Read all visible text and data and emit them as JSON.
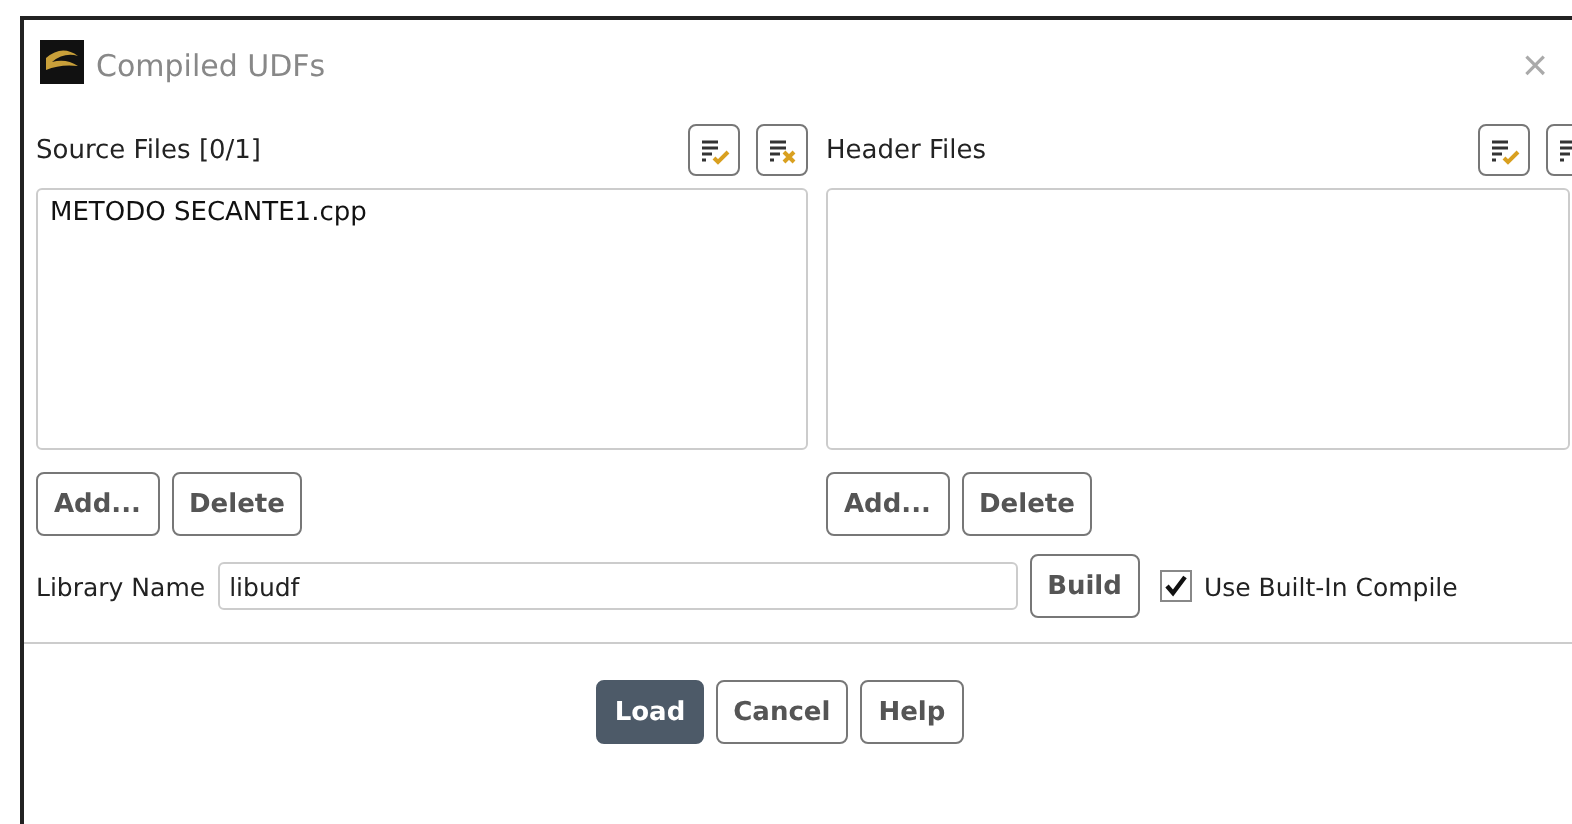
{
  "window": {
    "title": "Compiled UDFs",
    "close": "×"
  },
  "panels": [
    {
      "label": "Source Files [0/1]",
      "files": [
        {
          "name": "METODO SECANTE1.cpp",
          "selected": false
        }
      ],
      "buttons": [
        "Add...",
        "Delete"
      ]
    },
    {
      "label": "Header Files",
      "buttons": [
        "Add...",
        "Delete"
      ]
    }
  ],
  "library": {
    "label": "Library Name",
    "value": "libudf",
    "build": "Build"
  },
  "builtin": {
    "label": "Use Built-In Compile",
    "checked": true
  },
  "buttons": [
    {
      "label": "Load",
      "primary": true
    },
    {
      "label": "Cancel",
      "primary": false
    },
    {
      "label": "Help",
      "primary": false
    }
  ]
}
